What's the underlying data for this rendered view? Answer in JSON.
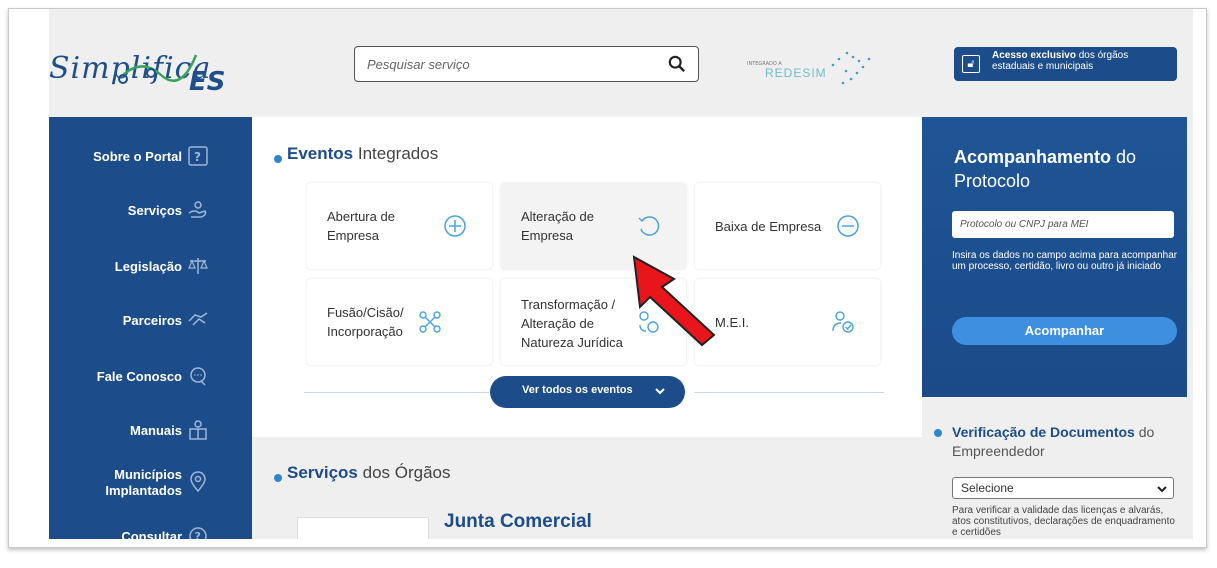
{
  "header": {
    "logo_text": "Simplifica",
    "logo_suffix": "ES",
    "search_placeholder": "Pesquisar serviço",
    "redesim_small": "INTEGRADO A",
    "redesim_big": "REDESIM",
    "acesso_bold": "Acesso exclusivo",
    "acesso_rest": " dos órgãos estaduais e municipais"
  },
  "sidebar": {
    "items": [
      {
        "label": "Sobre o Portal",
        "icon": "question-box-icon"
      },
      {
        "label": "Serviços",
        "icon": "hand-service-icon"
      },
      {
        "label": "Legislação",
        "icon": "scales-icon"
      },
      {
        "label": "Parceiros",
        "icon": "handshake-icon"
      },
      {
        "label": "Fale Conosco",
        "icon": "chat-icon"
      },
      {
        "label": "Manuais",
        "icon": "book-icon"
      },
      {
        "label": "Municípios Implantados",
        "icon": "map-pin-icon"
      },
      {
        "label": "Consultar",
        "icon": "question-circle-icon"
      }
    ]
  },
  "eventos": {
    "title_bold": "Eventos",
    "title_rest": " Integrados",
    "cards": [
      {
        "label": "Abertura de Empresa",
        "icon": "plus-circle-icon"
      },
      {
        "label": "Alteração de Empresa",
        "icon": "refresh-icon"
      },
      {
        "label": "Baixa de Empresa",
        "icon": "minus-circle-icon"
      },
      {
        "label": "Fusão/Cisão/ Incorporação",
        "icon": "nodes-icon"
      },
      {
        "label": "Transformação / Alteração de Natureza Jurídica",
        "icon": "transform-icon"
      },
      {
        "label": "M.E.I.",
        "icon": "user-check-icon"
      }
    ],
    "ver_todos": "Ver todos os eventos"
  },
  "servicos": {
    "title_bold": "Serviços",
    "title_rest": " dos Órgãos",
    "junta": "Junta Comercial"
  },
  "acompanhamento": {
    "title_bold": "Acompanhamento",
    "title_rest": " do Protocolo",
    "input_placeholder": "Protocolo ou CNPJ para MEI",
    "help": "Insira os dados no campo acima para acompanhar um processo, certidão, livro ou outro já iniciado",
    "button": "Acompanhar"
  },
  "verificacao": {
    "title_bold": "Verificação de Documentos",
    "title_rest": " do Empreendedor",
    "select_value": "Selecione",
    "help": "Para verificar a validade das licenças e alvarás, atos constitutivos, declarações de enquadramento e certidões"
  },
  "colors": {
    "primary": "#1c4d8a",
    "accent": "#3f8fe0",
    "arrow": "#e8161a"
  }
}
